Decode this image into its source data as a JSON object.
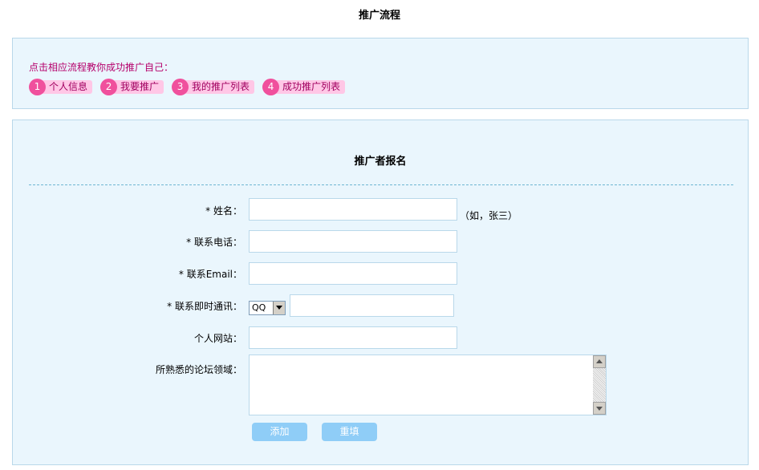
{
  "page": {
    "title": "推广流程"
  },
  "steps": {
    "intro": "点击相应流程教你成功推广自己：",
    "items": [
      {
        "num": "1",
        "label": "个人信息"
      },
      {
        "num": "2",
        "label": "我要推广"
      },
      {
        "num": "3",
        "label": "我的推广列表"
      },
      {
        "num": "4",
        "label": "成功推广列表"
      }
    ]
  },
  "form": {
    "title": "推广者报名",
    "fields": {
      "name": {
        "label": "* 姓名：",
        "value": "",
        "hint": "（如，张三）"
      },
      "phone": {
        "label": "* 联系电话：",
        "value": ""
      },
      "email": {
        "label": "* 联系Email：",
        "value": ""
      },
      "im": {
        "label": "* 联系即时通讯：",
        "selected": "QQ",
        "value": ""
      },
      "website": {
        "label": "个人网站：",
        "value": ""
      },
      "forums": {
        "label": "所熟悉的论坛领域：",
        "value": ""
      }
    },
    "buttons": {
      "add": "添加",
      "reset": "重填"
    }
  },
  "colors": {
    "panel_bg": "#eaf6fd",
    "panel_border": "#b9d8ea",
    "step_circle": "#f0509d",
    "step_label_bg": "#ffc7e6",
    "intro_text": "#b5006b",
    "button_bg": "#8fcdf7"
  },
  "icons": {
    "select_arrow": "chevron-down-icon",
    "scroll_up": "arrow-up-icon",
    "scroll_down": "arrow-down-icon"
  }
}
